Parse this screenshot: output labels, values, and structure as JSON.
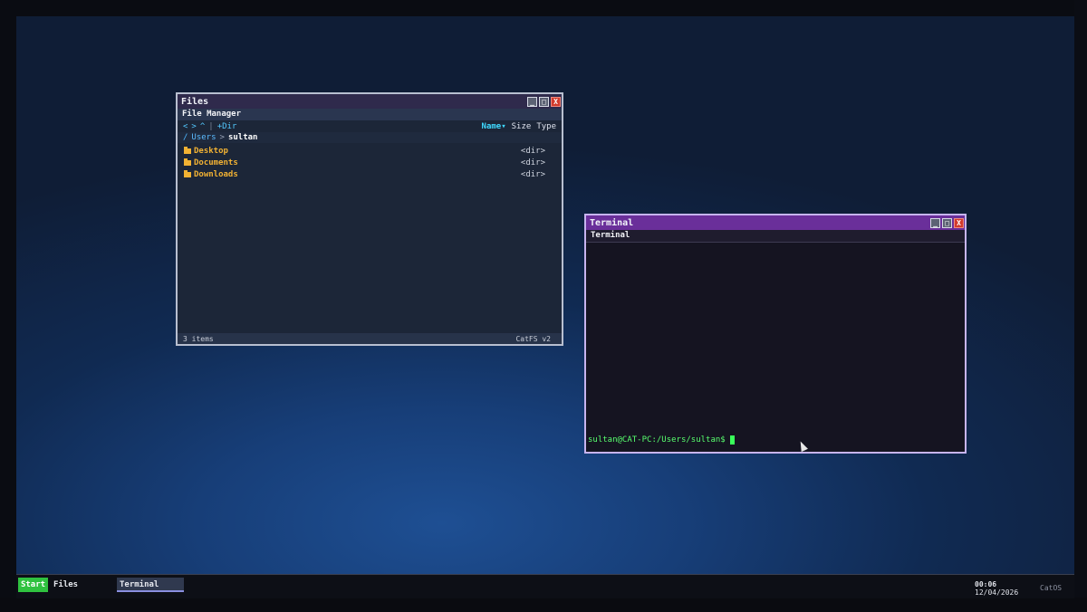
{
  "files_window": {
    "title": "Files",
    "header": "File Manager",
    "toolbar": {
      "back": "<",
      "forward": ">",
      "up": "^",
      "separator": "|",
      "new_dir": "+Dir",
      "col_name": "Name▾",
      "col_size": "Size",
      "col_type": "Type"
    },
    "path": {
      "root": "/",
      "crumb1": "Users",
      "chevron": ">",
      "current": "sultan"
    },
    "items": [
      {
        "name": "Desktop",
        "type": "<dir>"
      },
      {
        "name": "Documents",
        "type": "<dir>"
      },
      {
        "name": "Downloads",
        "type": "<dir>"
      }
    ],
    "status_left": "3 items",
    "status_right": "CatFS v2"
  },
  "terminal_window": {
    "title": "Terminal",
    "header": "Terminal",
    "prompt": "sultan@CAT-PC:/Users/sultan$"
  },
  "window_buttons": {
    "minimize": "_",
    "maximize": "□",
    "close": "X"
  },
  "taskbar": {
    "start": "Start",
    "tasks": [
      "Files",
      "Terminal"
    ],
    "time": "00:06",
    "date": "12/04/2026",
    "os_name": "CatOS"
  },
  "colors": {
    "start_button": "#2fc23f",
    "terminal_titlebar": "#6a2f9a",
    "folder": "#f2b233",
    "prompt_text": "#58ff6e",
    "close_button": "#d23b2d"
  }
}
